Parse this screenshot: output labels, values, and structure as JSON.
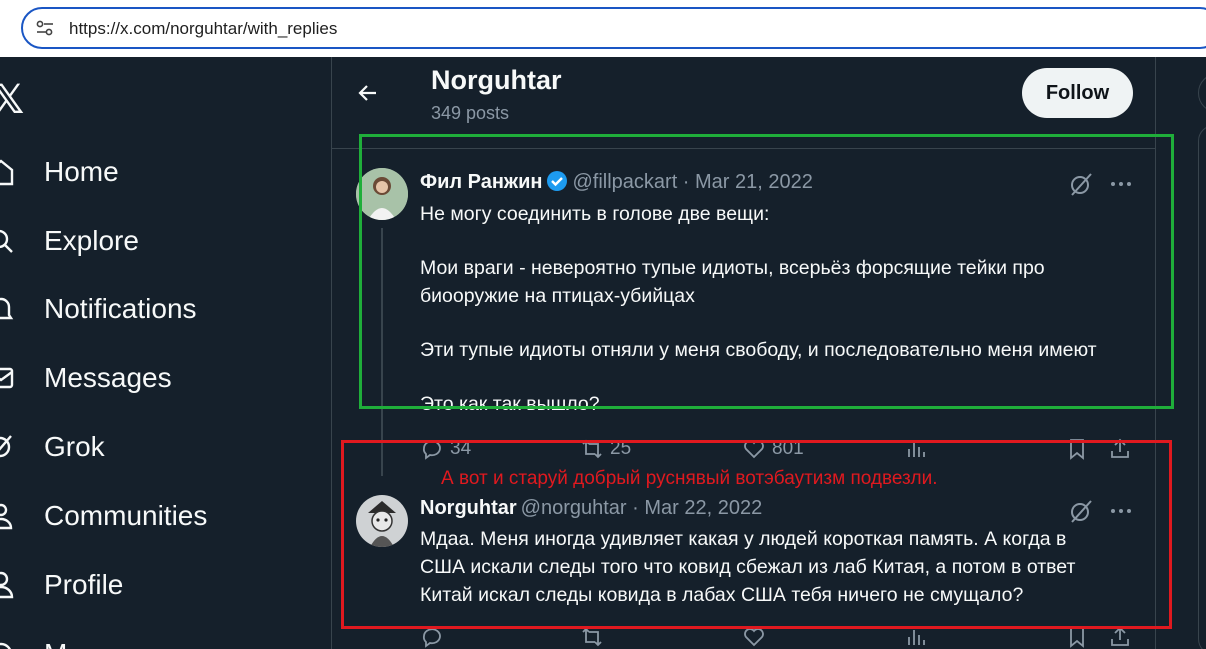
{
  "browser": {
    "url": "https://x.com/norguhtar/with_replies"
  },
  "nav": {
    "logo": "𝕏",
    "items": [
      {
        "label": "Home",
        "icon": "home-icon"
      },
      {
        "label": "Explore",
        "icon": "search-icon"
      },
      {
        "label": "Notifications",
        "icon": "bell-icon"
      },
      {
        "label": "Messages",
        "icon": "envelope-icon"
      },
      {
        "label": "Grok",
        "icon": "grok-icon"
      },
      {
        "label": "Communities",
        "icon": "communities-icon"
      },
      {
        "label": "Profile",
        "icon": "person-icon"
      },
      {
        "label": "M",
        "icon": "more-icon"
      }
    ]
  },
  "header": {
    "name": "Norguhtar",
    "posts": "349 posts",
    "follow_label": "Follow"
  },
  "tweets": [
    {
      "name": "Фил Ранжин",
      "meta": "@fillpackart · Mar 21, 2022",
      "verified": true,
      "lines": [
        "Не могу соединить в голове две вещи:",
        "Мои враги - невероятно тупые идиоты, всерьёз форсящие тейки про биооружие на птицах-убийцах",
        "Эти тупые идиоты отняли у меня свободу, и последовательно меня имеют",
        "Это как так вышло?"
      ],
      "replies": "34",
      "reposts": "25",
      "likes": "801"
    },
    {
      "name": "Norguhtar",
      "meta": "@norguhtar · Mar 22, 2022",
      "verified": false,
      "text": "Мдаа. Меня иногда удивляет какая у людей короткая память. А когда в США искали следы того что ковид сбежал из лаб Китая, а потом в ответ Китай искал следы ковида в лабах США тебя ничего не смущало?"
    }
  ],
  "annotation": {
    "text": "А вот и старуй добрый руснявый вотэбаутизм подвезли.",
    "green": "#1fae3a",
    "red": "#e0191f"
  },
  "colors": {
    "background": "#15202b",
    "muted": "#8b98a5",
    "verified": "#1d9bf0"
  }
}
